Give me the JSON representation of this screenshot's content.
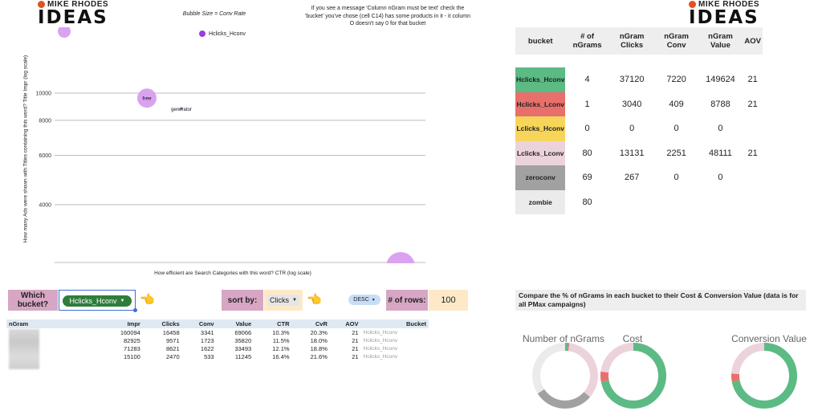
{
  "logo": {
    "top": "MIKE RHODES",
    "big": "IDEAS"
  },
  "header": {
    "bubble_note": "Bubble Size = Conv Rate",
    "warning": "If you see a message 'Column nGram must be text' check the 'bucket' you've chose (cell C14) has some products in it - it column O doesn't say 0 for that bucket"
  },
  "scatter": {
    "legend": "Hclicks_Hconv",
    "ylabel": "How many Ads were shown with Titles containing this word? Title Impr (log scale)",
    "xlabel": "How efficient are Search Categories with this word? CTR (log scale)",
    "ytick_labels": [
      "10000",
      "8000",
      "6000",
      "4000"
    ],
    "point_labels": [
      "free",
      "generator"
    ]
  },
  "chart_data": [
    {
      "type": "scatter",
      "title": "",
      "xlabel": "How efficient are Search Categories with this word? CTR (log scale)",
      "ylabel": "How many Ads were shown with Titles containing this word? Title Impr (log scale)",
      "y_scale": "log",
      "x_scale": "log",
      "yticks": [
        4000,
        6000,
        8000,
        10000
      ],
      "grid": true,
      "legend_position": "top",
      "series": [
        {
          "name": "Hclicks_Hconv",
          "color": "#d9a3f0",
          "points": [
            {
              "label": "free",
              "y": 9600,
              "size": "large"
            },
            {
              "label": "generator",
              "y": 8700,
              "size": "tiny"
            }
          ]
        }
      ]
    },
    {
      "type": "pie",
      "title": "Number of nGrams",
      "slices": [
        {
          "label": "Hclicks_Hconv",
          "value": 4,
          "color": "#5cba84"
        },
        {
          "label": "Hclicks_Lconv",
          "value": 1,
          "color": "#e8706c"
        },
        {
          "label": "Lclicks_Hconv",
          "value": 0,
          "color": "#f7d55a"
        },
        {
          "label": "Lclicks_Lconv",
          "value": 80,
          "color": "#ecd3db"
        },
        {
          "label": "zeroconv",
          "value": 69,
          "color": "#a1a1a1"
        },
        {
          "label": "zombie",
          "value": 80,
          "color": "#ebebeb"
        }
      ]
    },
    {
      "type": "pie",
      "title": "Cost",
      "slices": [
        {
          "label": "Hclicks_Hconv",
          "value": 72,
          "color": "#5cba84"
        },
        {
          "label": "Hclicks_Lconv",
          "value": 5,
          "color": "#e8706c"
        },
        {
          "label": "Lclicks_Lconv",
          "value": 23,
          "color": "#ecd3db"
        }
      ]
    },
    {
      "type": "pie",
      "title": "Conversion Value",
      "slices": [
        {
          "label": "Hclicks_Hconv",
          "value": 72,
          "color": "#5cba84"
        },
        {
          "label": "Hclicks_Lconv",
          "value": 4,
          "color": "#e8706c"
        },
        {
          "label": "Lclicks_Lconv",
          "value": 24,
          "color": "#ecd3db"
        }
      ]
    }
  ],
  "bucket_table": {
    "headers": [
      "bucket",
      "# of nGrams",
      "nGram Clicks",
      "nGram Conv",
      "nGram Value",
      "AOV"
    ],
    "rows": [
      {
        "bucket": "Hclicks_Hconv",
        "color": "#5cba84",
        "cells": [
          "4",
          "37120",
          "7220",
          "149624",
          "21"
        ]
      },
      {
        "bucket": "Hclicks_Lconv",
        "color": "#e8706c",
        "cells": [
          "1",
          "3040",
          "409",
          "8788",
          "21"
        ]
      },
      {
        "bucket": "Lclicks_Hconv",
        "color": "#f7d55a",
        "cells": [
          "0",
          "0",
          "0",
          "0",
          ""
        ]
      },
      {
        "bucket": "Lclicks_Lconv",
        "color": "#ecd3db",
        "cells": [
          "80",
          "13131",
          "2251",
          "48111",
          "21"
        ]
      },
      {
        "bucket": "zeroconv",
        "color": "#a1a1a1",
        "cells": [
          "69",
          "267",
          "0",
          "0",
          ""
        ]
      },
      {
        "bucket": "zombie",
        "color": "#ebebeb",
        "cells": [
          "80",
          "",
          "",
          "",
          ""
        ]
      }
    ]
  },
  "controls": {
    "which_bucket_label": "Which bucket?",
    "bucket_value": "Hclicks_Hconv",
    "sort_by_label": "sort by:",
    "sort_value": "Clicks",
    "order_value": "DESC",
    "rows_label": "# of rows:",
    "rows_value": "100",
    "dropdown_arrow": "▼",
    "hand_glyph": "👈"
  },
  "lower_table": {
    "headers": [
      "nGram",
      "Impr",
      "Clicks",
      "Conv",
      "Value",
      "CTR",
      "CvR",
      "AOV",
      "Bucket"
    ],
    "rows": [
      [
        "",
        "160094",
        "16458",
        "3341",
        "69066",
        "10.3%",
        "20.3%",
        "21",
        "Hclicks_Hconv"
      ],
      [
        "",
        "82925",
        "9571",
        "1723",
        "35820",
        "11.5%",
        "18.0%",
        "21",
        "Hclicks_Hconv"
      ],
      [
        "",
        "71283",
        "8621",
        "1622",
        "33493",
        "12.1%",
        "18.8%",
        "21",
        "Hclicks_Hconv"
      ],
      [
        "",
        "15100",
        "2470",
        "533",
        "11245",
        "16.4%",
        "21.6%",
        "21",
        "Hclicks_Hconv"
      ]
    ]
  },
  "compare": {
    "title": "Compare the % of nGrams in each bucket to their Cost & Conversion Value (data is for all PMax campaigns)"
  }
}
